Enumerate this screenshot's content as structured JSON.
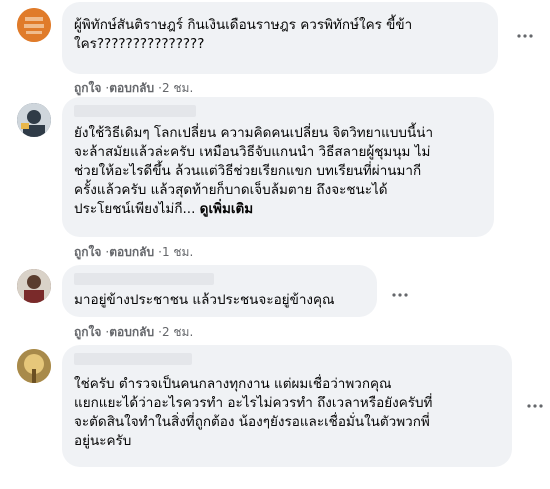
{
  "comments": [
    {
      "text": "ผู้พิทักษ์สันติราษฎร์ กินเงินเดือนราษฎร ควรพิทักษ์ใคร ขี้ข้า\nใคร???????????????",
      "see_more": "",
      "like": "ถูกใจ",
      "reply": "ตอบกลับ",
      "time": "2 ชม.",
      "avatar_color": "#e07b2a"
    },
    {
      "text": "ยังใช้วิธีเดิมๆ โลกเปลี่ยน ความคิดคนเปลี่ยน จิตวิทยาแบบนี้น่า\nจะล้าสมัยแล้วล่ะครับ เหมือนวิธีจับแกนนำ วิธีสลายผู้ชุมนุม ไม่\nช่วยให้อะไรดีขึ้น ล้วนแต่วิธีช่วยเรียกแขก บทเรียนที่ผ่านมากี\nครั้งแล้วครับ แล้วสุดท้ายก็บาดเจ็บล้มตาย ถึงจะชนะได้\nประโยชน์เพียงไม่กี...",
      "see_more": "ดูเพิ่มเติม",
      "like": "ถูกใจ",
      "reply": "ตอบกลับ",
      "time": "1 ชม.",
      "avatar_color": "#3a4a5a"
    },
    {
      "text": "มาอยู่ข้างประชาชน แล้วประชนจะอยู่ข้างคุณ",
      "see_more": "",
      "like": "ถูกใจ",
      "reply": "ตอบกลับ",
      "time": "2 ชม.",
      "avatar_color": "#6b4a3a"
    },
    {
      "text": "ใช่ครับ ตำรวจเป็นคนกลางทุกงาน แต่ผมเชื่อว่าพวกคุณ\nแยกแยะได้ว่าอะไรควรทำ อะไรไม่ควรทำ ถึงเวลาหรือยังครับที่\nจะตัดสินใจทำในสิ่งที่ถูกต้อง น้องๆยังรอและเชื่อมั่นในตัวพวกพี่\nอยู่นะครับ",
      "see_more": "",
      "like": "",
      "reply": "",
      "time": "",
      "avatar_color": "#c9a25a"
    }
  ],
  "separator": "·",
  "colors": {
    "bubble": "#f0f2f5",
    "meta_text": "#65676b",
    "name_redacted": "#e4e6ea"
  }
}
